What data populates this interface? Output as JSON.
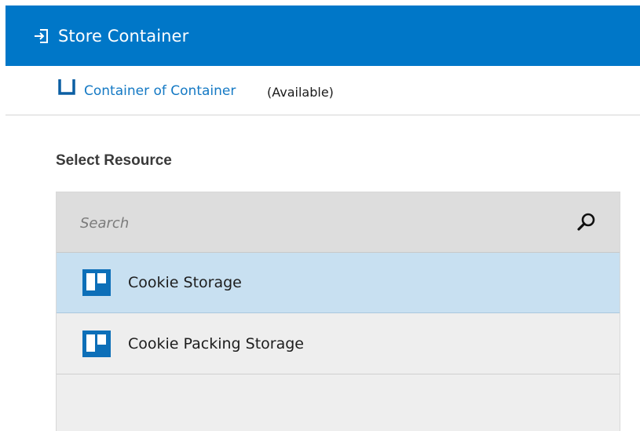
{
  "header": {
    "title": "Store Container",
    "icon": "store-arrow-icon",
    "background_color": "#0077c8"
  },
  "container": {
    "icon": "container-icon",
    "link_text": "Container of Container",
    "status": "(Available)",
    "link_color": "#1479c4"
  },
  "resource": {
    "section_label": "Select Resource",
    "search": {
      "placeholder": "Search",
      "value": "",
      "icon": "search-icon"
    },
    "items": [
      {
        "label": "Cookie Storage",
        "icon": "resource-board-icon",
        "selected": true
      },
      {
        "label": "Cookie Packing Storage",
        "icon": "resource-board-icon",
        "selected": false
      }
    ],
    "selected_color": "#c8e0f1"
  }
}
